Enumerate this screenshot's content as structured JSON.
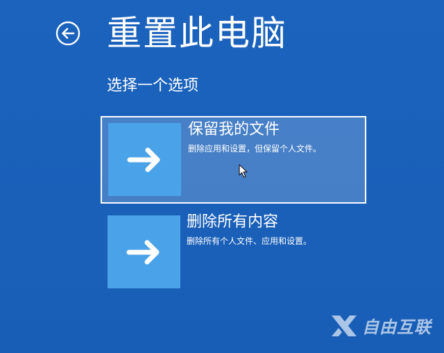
{
  "header": {
    "title": "重置此电脑",
    "back_icon": "back-arrow-circle-icon"
  },
  "subtitle": "选择一个选项",
  "options": [
    {
      "title": "保留我的文件",
      "description": "删除应用和设置，但保留个人文件。",
      "icon": "arrow-right-icon",
      "selected": true
    },
    {
      "title": "删除所有内容",
      "description": "删除所有个人文件、应用和设置。",
      "icon": "arrow-right-icon",
      "selected": false
    }
  ],
  "watermark": {
    "text": "自由互联",
    "icon": "x-logo-icon"
  },
  "colors": {
    "background": "#1b63bd",
    "tile": "#4aa3e8",
    "text": "#ffffff"
  }
}
